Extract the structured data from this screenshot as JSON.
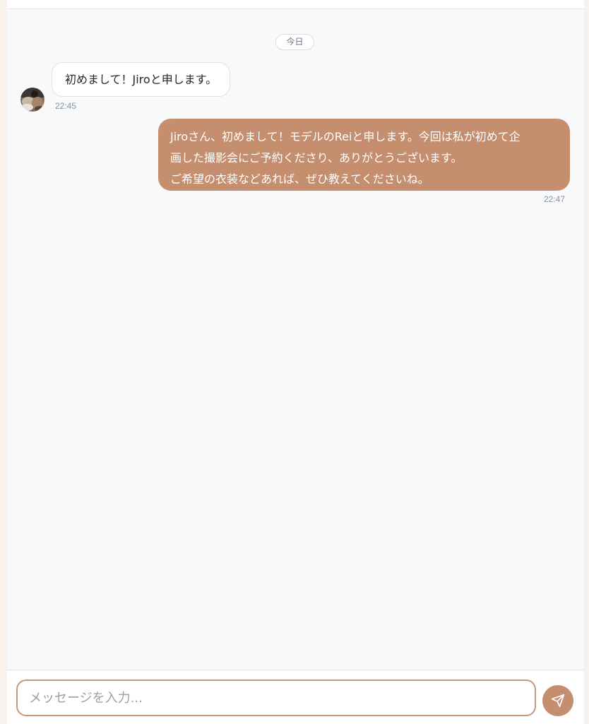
{
  "chat": {
    "date_separator": "今日",
    "messages": [
      {
        "direction": "incoming",
        "text": "初めまして！Jiroと申します。",
        "time": "22:45"
      },
      {
        "direction": "outgoing",
        "lines": [
          "Jiroさん、初めまして！モデルのReiと申します。今回は私が初めて企",
          "画した撮影会にご予約くださり、ありがとうございます。",
          "ご希望の衣装などあれば、ぜひ教えてくださいね。"
        ],
        "time": "22:47"
      }
    ]
  },
  "composer": {
    "placeholder": "メッセージを入力...",
    "value": ""
  },
  "icons": {
    "avatar": "avatar-photo",
    "send": "send-icon"
  },
  "colors": {
    "accent": "#c58f6f",
    "background": "#f8f9fb",
    "outer_background": "#f7f2ee"
  }
}
